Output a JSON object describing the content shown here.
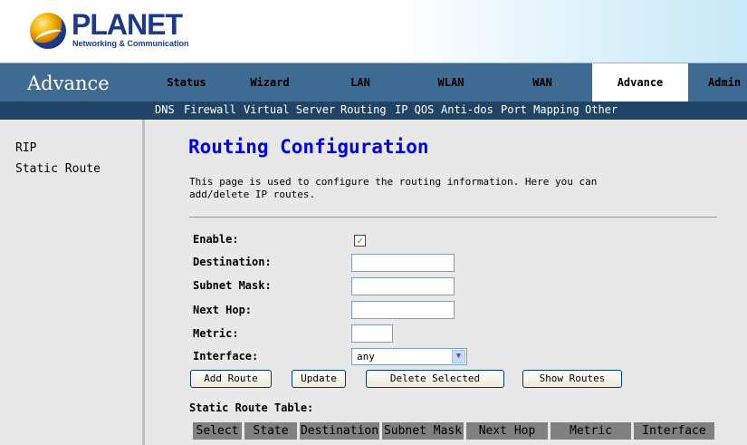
{
  "brand": {
    "name": "PLANET",
    "tagline": "Networking & Communication"
  },
  "section_title": "Advance",
  "main_nav": [
    {
      "label": "Status"
    },
    {
      "label": "Wizard"
    },
    {
      "label": "LAN"
    },
    {
      "label": "WLAN"
    },
    {
      "label": "WAN"
    },
    {
      "label": "Advance",
      "active": true
    },
    {
      "label": "Admin"
    }
  ],
  "sub_nav": [
    "DNS",
    "Firewall",
    "Virtual Server",
    "Routing",
    "IP QOS",
    "Anti-dos",
    "Port Mapping",
    "Other"
  ],
  "sidebar": [
    "RIP",
    "Static Route"
  ],
  "page": {
    "title": "Routing Configuration",
    "description": "This page is used to configure the routing information. Here you can add/delete IP routes."
  },
  "form": {
    "enable_label": "Enable:",
    "enable_checked": true,
    "destination_label": "Destination:",
    "destination_value": "",
    "subnet_label": "Subnet Mask:",
    "subnet_value": "",
    "nexthop_label": "Next Hop:",
    "nexthop_value": "",
    "metric_label": "Metric:",
    "metric_value": "",
    "interface_label": "Interface:",
    "interface_value": "any"
  },
  "buttons": {
    "add_route": "Add Route",
    "update": "Update",
    "delete_selected": "Delete Selected",
    "show_routes": "Show Routes"
  },
  "table": {
    "title": "Static Route Table:",
    "headers": [
      "Select",
      "State",
      "Destination",
      "Subnet Mask",
      "Next Hop",
      "Metric",
      "Interface"
    ]
  },
  "colors": {
    "nav_bar": "#3f6b92",
    "sub_nav_bar": "#1f4466",
    "title_blue": "#0000ee"
  }
}
